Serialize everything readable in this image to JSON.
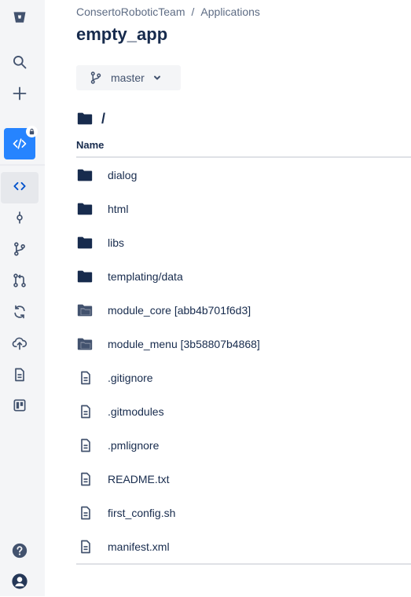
{
  "sidebar": {
    "icons": [
      "bitbucket-logo",
      "search-icon",
      "plus-icon",
      "repo-avatar",
      "code-icon",
      "commits-icon",
      "branches-icon",
      "pull-requests-icon",
      "pipelines-icon",
      "deployments-icon",
      "downloads-icon",
      "board-icon",
      "help-icon",
      "profile-icon"
    ]
  },
  "breadcrumb": {
    "team": "ConsertoRoboticTeam",
    "separator": "/",
    "project": "Applications"
  },
  "page_title": "empty_app",
  "branch": {
    "label": "master"
  },
  "path": "/",
  "table": {
    "header_name": "Name",
    "rows": [
      {
        "name": "dialog",
        "type": "folder"
      },
      {
        "name": "html",
        "type": "folder"
      },
      {
        "name": "libs",
        "type": "folder"
      },
      {
        "name": "templating/data",
        "type": "folder"
      },
      {
        "name": "module_core [abb4b701f6d3]",
        "type": "submodule"
      },
      {
        "name": "module_menu [3b58807b4868]",
        "type": "submodule"
      },
      {
        "name": ".gitignore",
        "type": "file"
      },
      {
        "name": ".gitmodules",
        "type": "file"
      },
      {
        "name": ".pmlignore",
        "type": "file"
      },
      {
        "name": "README.txt",
        "type": "file"
      },
      {
        "name": "first_config.sh",
        "type": "file"
      },
      {
        "name": "manifest.xml",
        "type": "file"
      }
    ]
  },
  "colors": {
    "accent": "#0052cc",
    "repo_avatar": "#2684ff",
    "sidebar_bg": "#f4f5f7",
    "text": "#172b4d"
  }
}
